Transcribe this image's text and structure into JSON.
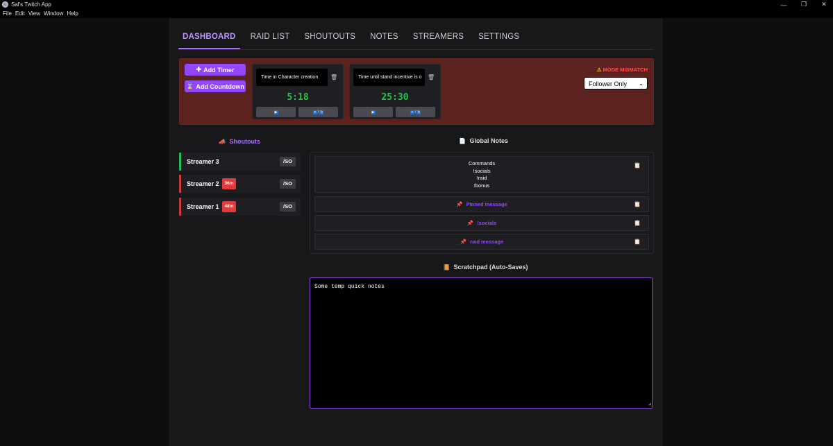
{
  "window": {
    "title": "Sal's Twitch App",
    "controls": [
      "—",
      "❐",
      "✕"
    ]
  },
  "menu": [
    "File",
    "Edit",
    "View",
    "Window",
    "Help"
  ],
  "tabs": [
    {
      "label": "DASHBOARD",
      "active": true
    },
    {
      "label": "RAID LIST"
    },
    {
      "label": "SHOUTOUTS"
    },
    {
      "label": "NOTES"
    },
    {
      "label": "STREAMERS"
    },
    {
      "label": "SETTINGS"
    }
  ],
  "timers": {
    "add_timer_label": "Add Timer",
    "add_countdown_label": "Add Countdown",
    "add_timer_icon": "✚",
    "add_countdown_icon": "⌛",
    "items": [
      {
        "name": "Time in Character creation",
        "value": "5:18"
      },
      {
        "name": "Time until stand incentive is o",
        "value": "25:30"
      }
    ],
    "delete_icon": "🗑",
    "play_icon": "▶",
    "pause_icon": "⏸",
    "reset_icon": "↻",
    "pause_reset_sep": "/"
  },
  "mode": {
    "warning_icon": "⚠",
    "warning": "MODE MISMATCH",
    "selected": "Follower Only",
    "chevron": "⌄"
  },
  "shoutouts": {
    "title": "Shoutouts",
    "icon": "📣",
    "button_label": "/SO",
    "items": [
      {
        "name": "Streamer 3",
        "badge": "",
        "status": "live"
      },
      {
        "name": "Streamer 2",
        "badge": "36m",
        "status": "offline"
      },
      {
        "name": "Streamer 1",
        "badge": "48m",
        "status": "offline"
      }
    ]
  },
  "notes": {
    "title": "Global Notes",
    "icon": "📄",
    "copy_icon": "📋",
    "pin_icon": "📌",
    "commands_lines": [
      "Commands",
      "!socials",
      "!raid",
      "!bonus"
    ],
    "pinned": [
      "Pinned message",
      "!socials",
      "raid message"
    ]
  },
  "scratchpad": {
    "title": "Scratchpad (Auto-Saves)",
    "icon": "📙",
    "value": "Some temp quick notes",
    "grip": "◢"
  },
  "colors": {
    "accent": "#9147ff",
    "timer_panel_bg": "#5c2220",
    "timer_green": "#27c24c",
    "live_green": "#1fbd55",
    "offline_red": "#d33b3b"
  }
}
